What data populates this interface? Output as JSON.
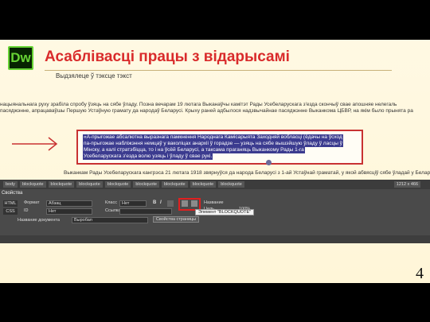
{
  "logo_text": "Dw",
  "title": "Асаблівасці працы з відарысамі",
  "subtitle": "Выдзялеце ў тэксце тэкст",
  "doc": {
    "line1": "нацыянальнага руху зрабіла спробу ўзяць на сябе ўладу. Позна вечарам 19 лютага Выканаўчы камітэт Рады Усебеларускага з'езда скончыў свае апошняе нелегаль",
    "line2": "пасяджэнне, апрацаваўшы Першую Устаўную грамату да народаў Беларусі. Крыху раней адбылося надзвычайнае пасяджэнне Выканкома ЦБВР, на якім было прынята ра",
    "line3": "",
    "line4": "Выканкам Рады Усебеларускага кангрэса 21 лютага 1918 звярнуўся да народа Беларусі з 1-ай Устаўнай граматай, у якой абвясціў сябе ўладай у Беларусі. Часовым",
    "line5": ""
  },
  "blockquote": {
    "l1": "«А-прыгожае абсалютна выразнага памкнення Народнага Камісарыята Заходняй вобласці (ёдачы на ўсход",
    "l2": "па-прыгожае наблiжэння немцаў у ваколiцах анархіі ў горадзе — узяць на сябе вышэйшую ўладу ў ласцы ў",
    "l3": "Мінску, а калі стратэбіцца, то і на ўсёй Беларусі, а таксама праганяць Выканкому Рады 1-га",
    "l4": "Усебеларускага з'езда волю узяць і ўладу ў свае рукі.",
    "l5": ""
  },
  "devbar": {
    "crumbs": [
      "body",
      "blockquote",
      "blockquote",
      "blockquote",
      "blockquote",
      "blockquote",
      "blockquote",
      "blockquote",
      "blockquote"
    ],
    "zoom": "1212 x 466"
  },
  "props": {
    "tab": "Свойства",
    "html_label": "HTML",
    "css_label": "CSS",
    "format_label": "Формат",
    "format_value": "Абзац",
    "class_label": "Класс",
    "class_value": "Нет",
    "id_label": "ID",
    "id_value": "Нет",
    "link_label": "Ссылка",
    "doc_title_label": "Название документа",
    "doc_title_value": "Выробап",
    "bold": "B",
    "italic": "I",
    "name_label": "Название",
    "target_label": "Цель",
    "width_value": "100%",
    "tooltip": "Элемент \"BLOCKQUOTE\"",
    "css_button": "Свойства страницы"
  },
  "page_number": "4",
  "colors": {
    "title": "#d92b2b",
    "accent_bar": "#f7c623",
    "highlight_box": "#c83232",
    "logo_green": "#67d334"
  }
}
